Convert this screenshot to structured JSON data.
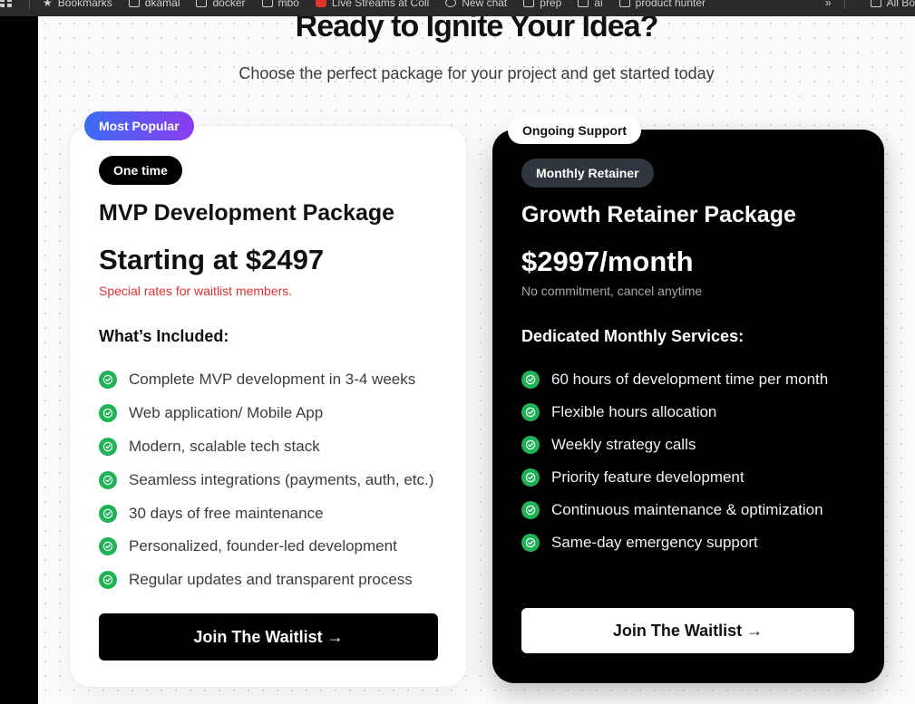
{
  "browser": {
    "bookmarks": [
      {
        "label": "Bookmarks",
        "icon": "star-icon"
      },
      {
        "label": "dkamal",
        "icon": "folder-icon"
      },
      {
        "label": "docker",
        "icon": "folder-icon"
      },
      {
        "label": "mbo",
        "icon": "folder-icon"
      },
      {
        "label": "Live Streams at Coll",
        "icon": "red-app-icon"
      },
      {
        "label": "New chat",
        "icon": "chat-icon"
      },
      {
        "label": "prep",
        "icon": "folder-icon"
      },
      {
        "label": "ai",
        "icon": "folder-icon"
      },
      {
        "label": "product hunter",
        "icon": "folder-icon"
      }
    ],
    "overflow_label": "»",
    "all_bookmarks_label": "All Bo"
  },
  "hero": {
    "headline": "Ready to Ignite Your Idea?",
    "subheadline": "Choose the perfect package for your project and get started today"
  },
  "plans": [
    {
      "ribbon": "Most Popular",
      "tag": "One time",
      "title": "MVP Development Package",
      "price": "Starting at $2497",
      "note": "Special rates for waitlist members.",
      "section_heading": "What’s Included:",
      "features": [
        "Complete MVP development in 3-4 weeks",
        "Web application/ Mobile App",
        "Modern, scalable tech stack",
        "Seamless integrations (payments, auth, etc.)",
        "30 days of free maintenance",
        "Personalized, founder-led development",
        "Regular updates and transparent process"
      ],
      "cta": "Join The Waitlist →"
    },
    {
      "ribbon": "Ongoing Support",
      "tag": "Monthly Retainer",
      "title": "Growth Retainer Package",
      "price": "$2997/month",
      "note": "No commitment, cancel anytime",
      "section_heading": "Dedicated Monthly Services:",
      "features": [
        "60 hours of development time per month",
        "Flexible hours allocation",
        "Weekly strategy calls",
        "Priority feature development",
        "Continuous maintenance & optimization",
        "Same-day emergency support"
      ],
      "cta": "Join The Waitlist →"
    }
  ],
  "colors": {
    "accent_gradient_start": "#3b6cf5",
    "accent_gradient_end": "#8a3cf0",
    "check_green": "#1fb356",
    "note_red": "#e03131"
  }
}
